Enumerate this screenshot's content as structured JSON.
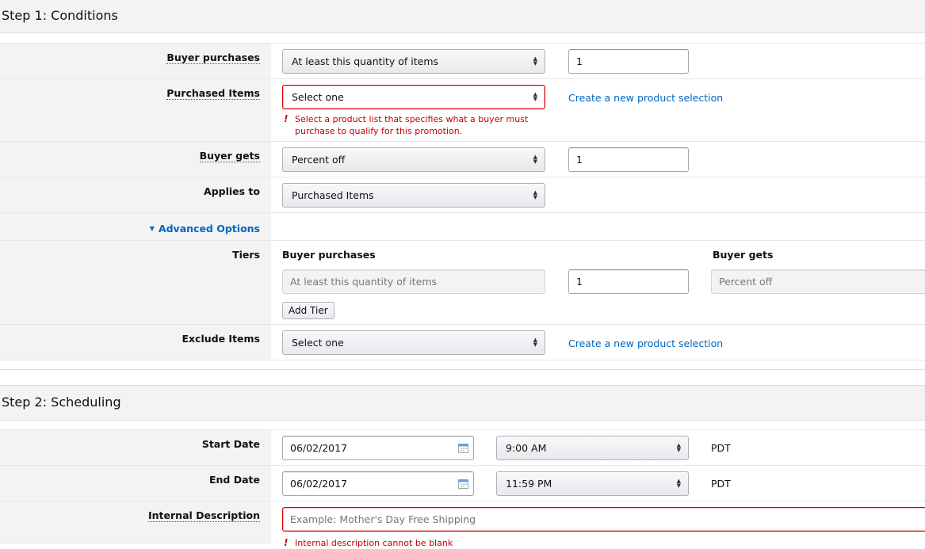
{
  "step1": {
    "title": "Step 1: Conditions",
    "rows": {
      "buyer_purchases": {
        "label": "Buyer purchases",
        "select": "At least this quantity of items",
        "value": "1"
      },
      "purchased_items": {
        "label": "Purchased Items",
        "select": "Select one",
        "link": "Create a new product selection",
        "error_line1": "Select a product list that specifies what a buyer must",
        "error_line2": "purchase to qualify for this promotion."
      },
      "buyer_gets": {
        "label": "Buyer gets",
        "select": "Percent off",
        "value": "1"
      },
      "applies_to": {
        "label": "Applies to",
        "select": "Purchased Items"
      },
      "advanced_options": {
        "label": "Advanced Options"
      },
      "tiers": {
        "label": "Tiers",
        "col_buyer_purchases": "Buyer purchases",
        "col_buyer_gets": "Buyer gets",
        "purchases_value": "At least this quantity of items",
        "quantity": "1",
        "gets_value": "Percent off",
        "add_tier": "Add Tier"
      },
      "exclude_items": {
        "label": "Exclude Items",
        "select": "Select one",
        "link": "Create a new product selection"
      }
    }
  },
  "step2": {
    "title": "Step 2: Scheduling",
    "rows": {
      "start_date": {
        "label": "Start Date",
        "date": "06/02/2017",
        "time": "9:00 AM",
        "tz": "PDT"
      },
      "end_date": {
        "label": "End Date",
        "date": "06/02/2017",
        "time": "11:59 PM",
        "tz": "PDT"
      },
      "internal_description": {
        "label": "Internal Description",
        "placeholder": "Example: Mother's Day Free Shipping",
        "error": "Internal description cannot be blank"
      }
    }
  },
  "colors": {
    "link": "#0066c0",
    "error": "#c40000",
    "label_bg": "#f3f3f3"
  },
  "icons": {
    "select_arrows": "updown-arrows-icon",
    "calendar": "calendar-icon",
    "triangle": "triangle-down-icon",
    "error": "exclamation-icon"
  }
}
